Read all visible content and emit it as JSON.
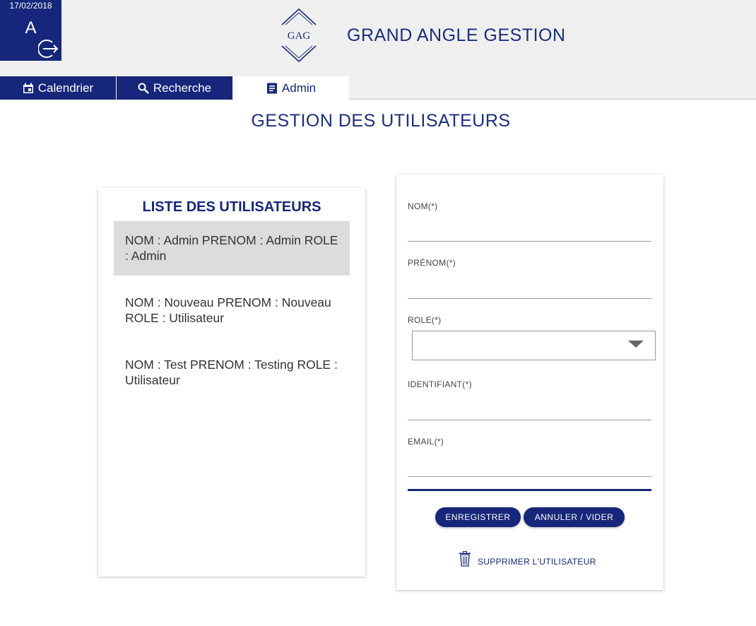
{
  "user": {
    "date": "17/02/2018",
    "initial": "A"
  },
  "header": {
    "logo_text": "GAG",
    "title": "GRAND ANGLE GESTION"
  },
  "tabs": [
    {
      "label": "Calendrier",
      "icon": "calendar-icon"
    },
    {
      "label": "Recherche",
      "icon": "search-icon"
    },
    {
      "label": "Admin",
      "icon": "document-icon",
      "active": true
    }
  ],
  "page": {
    "title": "GESTION DES UTILISATEURS"
  },
  "user_list": {
    "title": "LISTE DES UTILISATEURS",
    "items": [
      {
        "text": "NOM : Admin PRENOM : Admin ROLE : Admin",
        "selected": true
      },
      {
        "text": "NOM : Nouveau PRENOM : Nouveau ROLE : Utilisateur",
        "selected": false
      },
      {
        "text": "NOM : Test PRENOM : Testing ROLE : Utilisateur",
        "selected": false
      }
    ]
  },
  "form": {
    "nom_label": "NOM(*)",
    "nom_value": "",
    "prenom_label": "PRÉNOM(*)",
    "prenom_value": "",
    "role_label": "ROLE(*)",
    "role_value": "",
    "identifiant_label": "IDENTIFIANT(*)",
    "identifiant_value": "",
    "email_label": "EMAIL(*)",
    "email_value": "",
    "save_label": "ENREGISTRER",
    "cancel_label": "ANNULER / VIDER",
    "delete_label": "SUPPRIMER L'UTILISATEUR"
  },
  "colors": {
    "primary": "#16267a",
    "title": "#1a2e7e",
    "header_bg": "#efefef",
    "selected_row": "#dcdcdc"
  }
}
